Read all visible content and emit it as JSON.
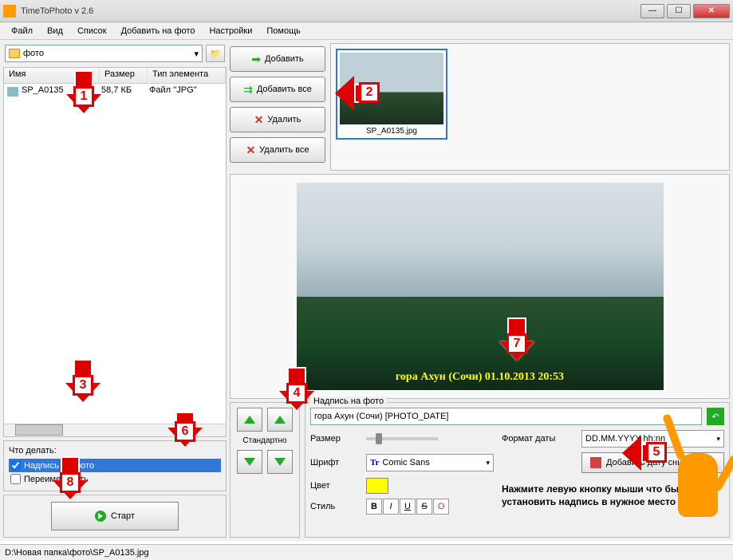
{
  "window": {
    "title": "TimeToPhoto v 2.6"
  },
  "menu": {
    "file": "Файл",
    "view": "Вид",
    "list": "Список",
    "add": "Добавить на фото",
    "settings": "Настройки",
    "help": "Помощь"
  },
  "path": {
    "folder": "фото"
  },
  "filelist": {
    "cols": {
      "name": "Имя",
      "size": "Размер",
      "type": "Тип элемента"
    },
    "rows": [
      {
        "name": "SP_A0135",
        "size": "58,7 КБ",
        "type": "Файл ''JPG''"
      }
    ]
  },
  "actions": {
    "add": "Добавить",
    "addall": "Добавить все",
    "del": "Удалить",
    "delall": "Удалить все"
  },
  "thumb": {
    "caption": "SP_A0135.jpg"
  },
  "preview": {
    "stamp": "гора Ахун (Сочи) 01.10.2013 20:53"
  },
  "todo": {
    "label": "Что делать:",
    "caption": "Надпись на фото",
    "rename": "Переименовать"
  },
  "start": {
    "label": "Старт"
  },
  "arrows": {
    "standard": "Стандартно"
  },
  "caption": {
    "grouplabel": "Надпись на фото",
    "text": "гора Ахун (Сочи) [PHOTO_DATE]",
    "size": "Размер",
    "font": "Шрифт",
    "fontval": "Comic Sans",
    "color": "Цвет",
    "style": "Стиль",
    "dateformat": "Формат даты",
    "dateformatval": "DD.MM.YYYY hh:nn",
    "adddate": "Добавить дату снимка",
    "instruction": "Нажмите левую кнопку мыши что бы установить надпись в нужное место"
  },
  "status": {
    "path": "D:\\Новая папка\\фото\\SP_A0135.jpg"
  },
  "nums": {
    "n1": "1",
    "n2": "2",
    "n3": "3",
    "n4": "4",
    "n5": "5",
    "n6": "6",
    "n7": "7",
    "n8": "8"
  }
}
